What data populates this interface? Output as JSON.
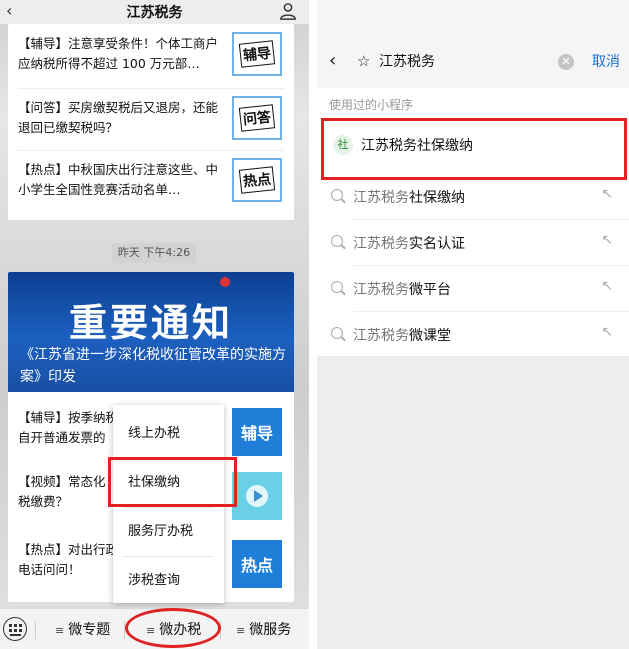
{
  "left": {
    "header": {
      "back_icon": "chevron-left-icon",
      "title": "江苏税务",
      "user_icon": "person-icon"
    },
    "top_articles": [
      {
        "text": "【辅导】注意享受条件！个体工商户应纳税所得不超过 100 万元部…",
        "thumb": "辅导"
      },
      {
        "text": "【问答】买房缴契税后又退房，还能退回已缴契税吗？",
        "thumb": "问答"
      },
      {
        "text": "【热点】中秋国庆出行注意这些、中小学生全国性竞赛活动名单…",
        "thumb": "热点"
      }
    ],
    "timestamp": "昨天 下午4:26",
    "banner": {
      "headline": "重要通知",
      "subtitle": "《江苏省进一步深化税收征管改革的实施方案》印发"
    },
    "bottom_articles": [
      {
        "text": "【辅导】按季纳税",
        "text2": "自开普通发票的",
        "thumb": "辅导"
      },
      {
        "text": "【视频】常态化",
        "text2": "税缴费？",
        "thumb": ""
      },
      {
        "text": "【热点】对出行政",
        "text2": "电话问问！",
        "thumb": "热点"
      }
    ],
    "menu": [
      "线上办税",
      "社保缴纳",
      "服务厅办税",
      "涉税查询"
    ],
    "bottom_bar": {
      "keyboard_icon": "keyboard-icon",
      "tabs": [
        "微专题",
        "微办税",
        "微服务"
      ],
      "tab_icon": "≡"
    }
  },
  "right": {
    "search": {
      "back_icon": "chevron-left-icon",
      "star_icon": "star-icon",
      "query": "江苏税务",
      "clear_icon": "clear-icon",
      "cancel": "取消"
    },
    "section_label": "使用过的小程序",
    "mini_program": {
      "logo": "社",
      "name": "江苏税务社保缴纳"
    },
    "suggestions": [
      {
        "prefix": "江苏税务",
        "suffix": "社保缴纳"
      },
      {
        "prefix": "江苏税务",
        "suffix": "实名认证"
      },
      {
        "prefix": "江苏税务",
        "suffix": "微平台"
      },
      {
        "prefix": "江苏税务",
        "suffix": "微课堂"
      }
    ],
    "fill_arrow": "↖"
  },
  "colors": {
    "highlight": "#e02222",
    "link": "#1d6fd1",
    "banner": "#1c60c0"
  }
}
